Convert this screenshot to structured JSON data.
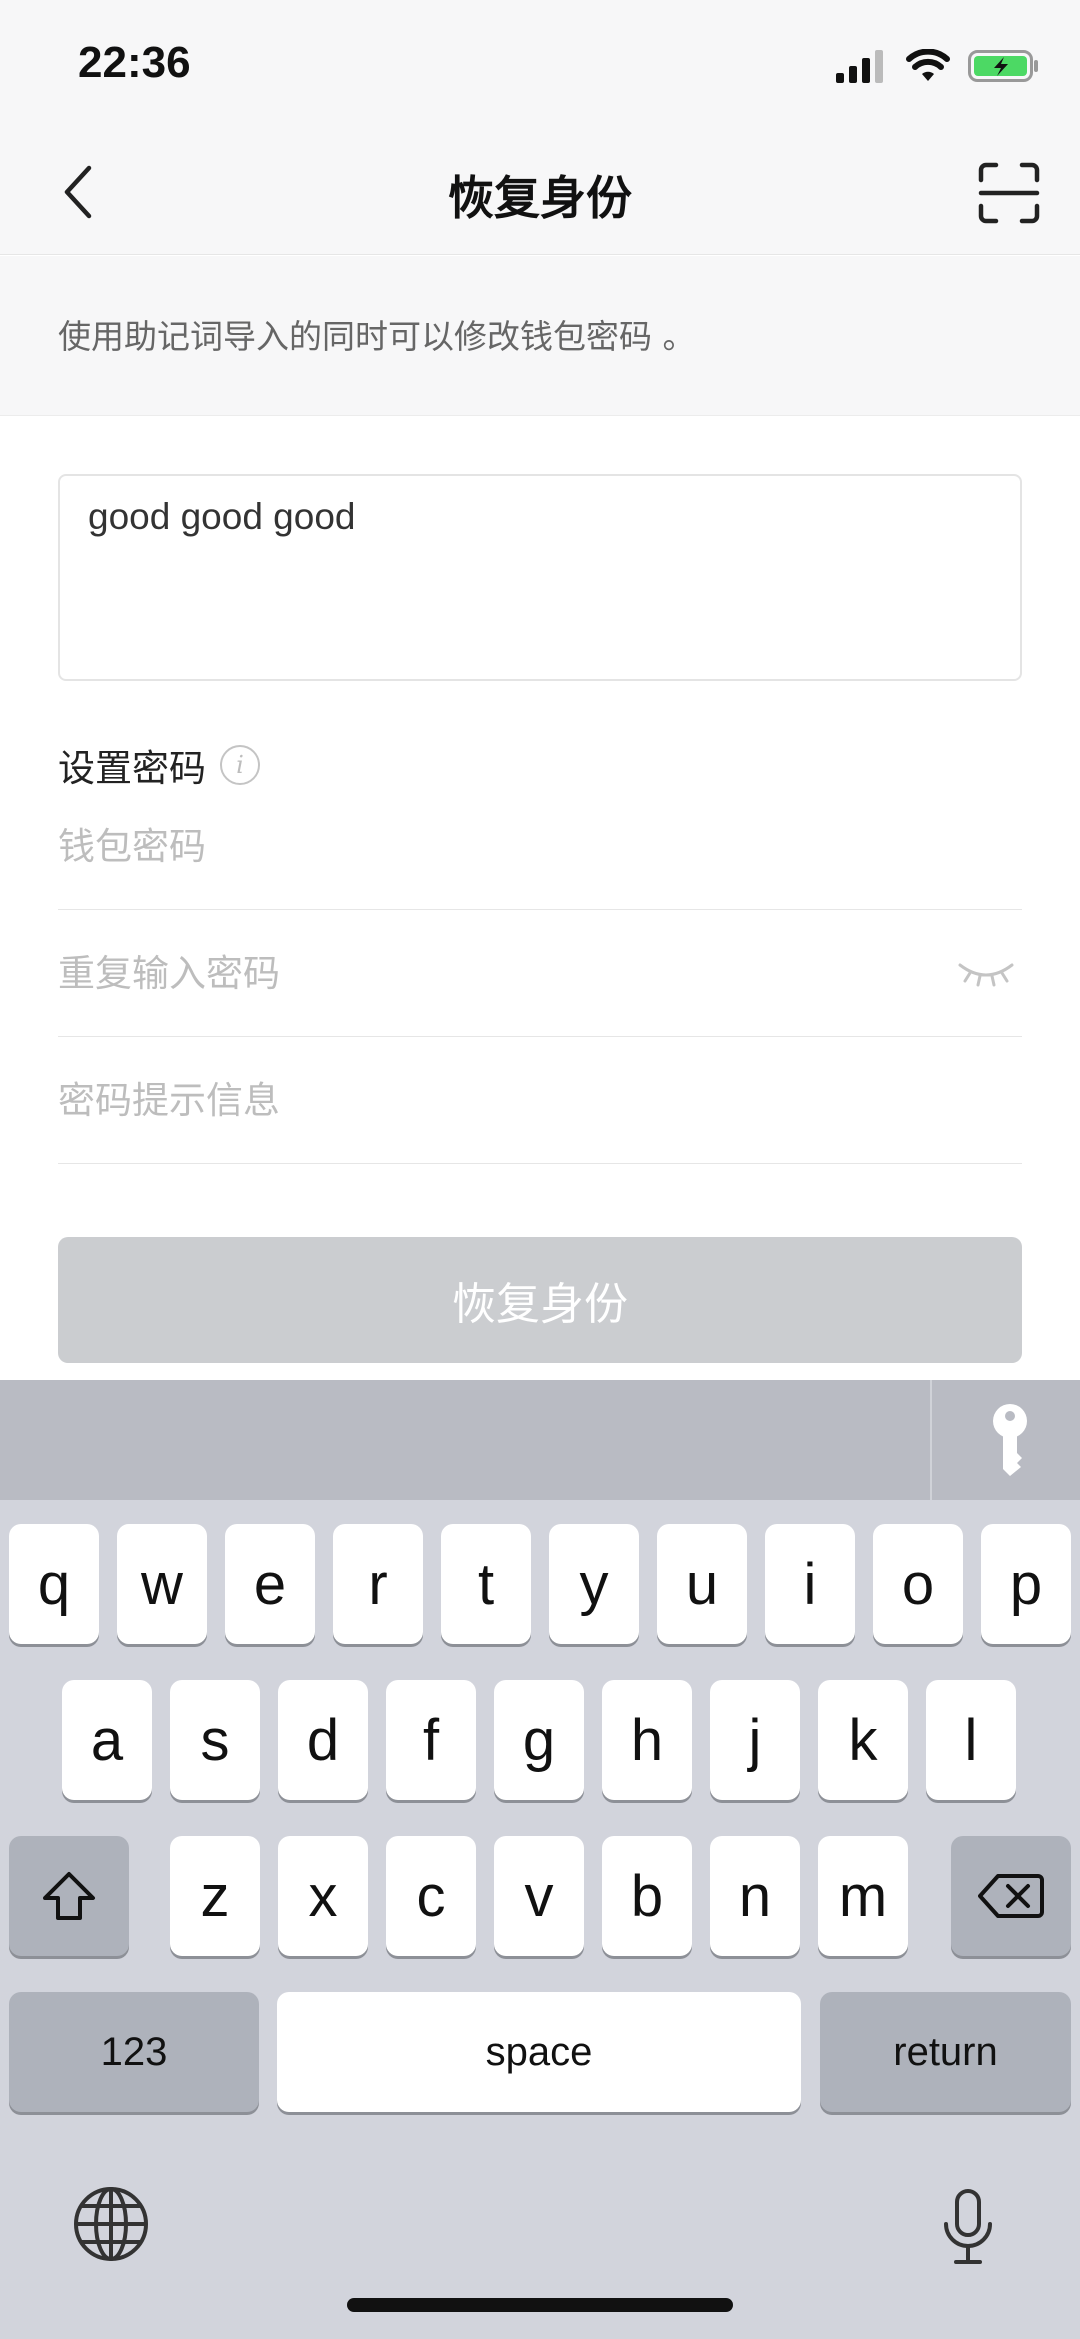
{
  "status_bar": {
    "time": "22:36"
  },
  "nav": {
    "title": "恢复身份"
  },
  "hint": {
    "text": "使用助记词导入的同时可以修改钱包密码 。"
  },
  "form": {
    "mnemonic_value": "good good good",
    "section_label": "设置密码",
    "password_placeholder": "钱包密码",
    "repeat_placeholder": "重复输入密码",
    "hint_placeholder": "密码提示信息",
    "submit_label": "恢复身份"
  },
  "keyboard": {
    "row1": [
      "q",
      "w",
      "e",
      "r",
      "t",
      "y",
      "u",
      "i",
      "o",
      "p"
    ],
    "row2": [
      "a",
      "s",
      "d",
      "f",
      "g",
      "h",
      "j",
      "k",
      "l"
    ],
    "row3": [
      "z",
      "x",
      "c",
      "v",
      "b",
      "n",
      "m"
    ],
    "numbers_label": "123",
    "space_label": "space",
    "return_label": "return"
  },
  "colors": {
    "submit_disabled": "#cbcdd0",
    "keyboard_bg": "#d2d4dc",
    "accessory_bg": "#b9bbc3"
  },
  "icons": [
    "back-icon",
    "scan-icon",
    "info-icon",
    "eye-closed-icon",
    "key-icon",
    "shift-icon",
    "delete-icon",
    "globe-icon",
    "mic-icon"
  ]
}
